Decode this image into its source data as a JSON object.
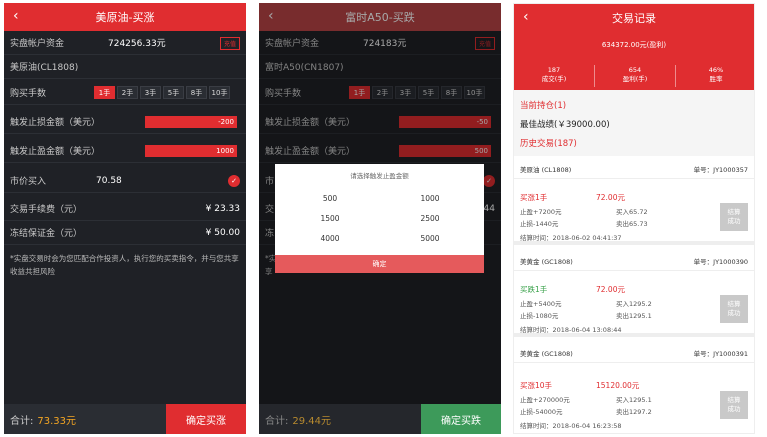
{
  "panel1": {
    "title": "美原油-买涨",
    "rows": {
      "account_label": "实盘帐户资金",
      "account_value": "724256.33元",
      "account_badge": "充值",
      "product": "美原油(CL1808)",
      "lots_label": "购买手数",
      "lots": [
        "1手",
        "2手",
        "3手",
        "5手",
        "8手",
        "10手"
      ],
      "stoploss_label": "触发止损金额（美元）",
      "stoploss_value": "-200",
      "takeprofit_label": "触发止盈金额（美元）",
      "takeprofit_value": "1000",
      "market_label": "市价买入",
      "market_value": "70.58",
      "fee_label": "交易手续费（元）",
      "fee_value": "¥ 23.33",
      "margin_label": "冻结保证金（元）",
      "margin_value": "¥ 50.00",
      "note": "*实盘交易时会为您匹配合作投资人，执行您的买卖指令，并与您共享收益共担风险"
    },
    "total_label": "合计:",
    "total_value": "73.33元",
    "confirm": "确定买涨"
  },
  "panel2": {
    "title": "富时A50-买跌",
    "rows": {
      "account_label": "实盘帐户资金",
      "account_value": "724183元",
      "account_badge": "充值",
      "product": "富时A50(CN1807)",
      "lots_label": "购买手数",
      "lots": [
        "1手",
        "2手",
        "3手",
        "5手",
        "8手",
        "10手"
      ],
      "stoploss_label": "触发止损金额（美元）",
      "stoploss_value": "-50",
      "takeprofit_label": "触发止盈金额（美元）",
      "takeprofit_value": "500",
      "r1": "市",
      "r2": "交",
      "r3": "冻",
      "r4": "*实",
      "r5": "享",
      "r6": "44"
    },
    "dialog": {
      "title": "请选择触发止盈金额",
      "options": [
        "500",
        "1000",
        "1500",
        "2500",
        "4000",
        "5000"
      ],
      "confirm": "确定"
    },
    "total_label": "合计:",
    "total_value": "29.44元",
    "confirm": "确定买跌"
  },
  "panel3": {
    "title": "交易记录",
    "total": "634372.00元(盈利)",
    "stats": [
      {
        "value": "187",
        "label": "成交(手)"
      },
      {
        "value": "654",
        "label": "盈利(手)"
      },
      {
        "value": "46%",
        "label": "胜率"
      }
    ],
    "current_holding": "当前持仓(1)",
    "best_record": "最佳战绩(￥39000.00)",
    "history": "历史交易(187)",
    "records": [
      {
        "name": "美原油 (CL1808)",
        "id": "单号：JY1000357",
        "direction": "买涨1手",
        "amount": "72.00元",
        "profit": "止盈+7200元",
        "loss": "止损-1440元",
        "buy": "买入65.72",
        "sell": "卖出65.73",
        "time": "结算时间：2018-06-02 04:41:37",
        "status": "结算\n成功",
        "dir_color": "red"
      },
      {
        "name": "美黄金 (GC1808)",
        "id": "单号：JY1000390",
        "direction": "买跌1手",
        "amount": "72.00元",
        "profit": "止盈+5400元",
        "loss": "止损-1080元",
        "buy": "买入1295.2",
        "sell": "卖出1295.1",
        "time": "结算时间：2018-06-04 13:08:44",
        "status": "结算\n成功",
        "dir_color": "green"
      },
      {
        "name": "美黄金 (GC1808)",
        "id": "单号：JY1000391",
        "direction": "买涨10手",
        "amount": "15120.00元",
        "profit": "止盈+270000元",
        "loss": "止损-54000元",
        "buy": "买入1295.1",
        "sell": "卖出1297.2",
        "time": "结算时间：2018-06-04 16:23:58",
        "status": "结算\n成功",
        "dir_color": "red"
      }
    ]
  },
  "colors": {
    "accent": "#e02d30",
    "green_button": "#3d9a5a",
    "gold": "#f5a623"
  }
}
